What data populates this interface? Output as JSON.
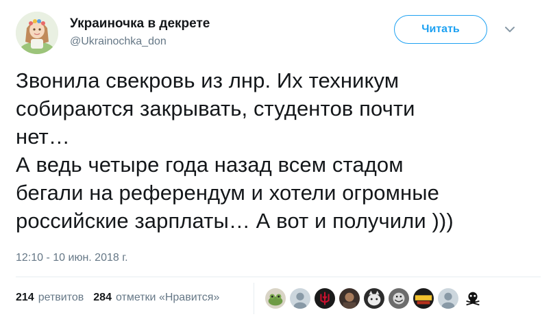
{
  "user": {
    "display_name": "Украиночка в декрете",
    "handle": "@Ukrainochka_don"
  },
  "actions": {
    "follow_label": "Читать",
    "menu_icon": "chevron-down-icon"
  },
  "tweet": {
    "lines": [
      "Звонила свекровь из лнр. Их техникум",
      "собираются закрывать, студентов почти",
      "нет…",
      "А ведь четыре года назад всем стадом",
      "бегали на референдум и хотели огромные",
      "российские зарплаты… А вот и получили  )))"
    ],
    "timestamp": "12:10 - 10 июн. 2018 г."
  },
  "stats": {
    "retweets_count": "214",
    "retweets_label": "ретвитов",
    "likes_count": "284",
    "likes_label": "отметки «Нравится»"
  },
  "liker_avatars": [
    "frog-avatar",
    "default-avatar",
    "trident-avatar",
    "photo-avatar",
    "cat-avatar",
    "cartoon-avatar",
    "sticker-avatar",
    "default-avatar",
    "skull-avatar"
  ],
  "colors": {
    "accent": "#1da1f2",
    "text_primary": "#14171a",
    "text_secondary": "#657786",
    "divider": "#e6ecf0"
  }
}
